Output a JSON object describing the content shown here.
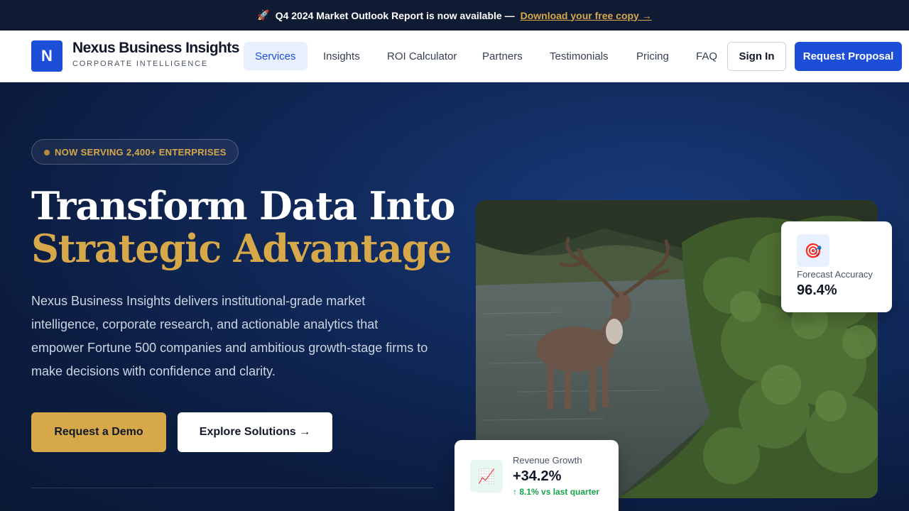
{
  "announcement": {
    "icon": "rocket-icon",
    "text": "Q4 2024 Market Outlook Report is now available —",
    "link": "Download your free copy →"
  },
  "nav": {
    "brand_initial": "N",
    "brand_name": "Nexus Business Insights",
    "brand_tagline": "CORPORATE INTELLIGENCE",
    "links": [
      {
        "label": "Services",
        "active": true
      },
      {
        "label": "Insights"
      },
      {
        "label": "ROI Calculator"
      },
      {
        "label": "Partners"
      },
      {
        "label": "Testimonials"
      },
      {
        "label": "Pricing"
      },
      {
        "label": "FAQ"
      }
    ],
    "signin_label": "Sign In",
    "cta_label": "Request Proposal"
  },
  "hero": {
    "badge": "NOW SERVING 2,400+ ENTERPRISES",
    "title_line1": "Transform Data Into",
    "title_line2": "Strategic Advantage",
    "lead": "Nexus Business Insights delivers institutional-grade market intelligence, corporate research, and actionable analytics that empower Fortune 500 companies and ambitious growth-stage firms to make decisions with confidence and clarity.",
    "primary_button": "Request a Demo",
    "secondary_button": "Explore Solutions →"
  },
  "stats": {
    "forecast": {
      "icon": "target-icon",
      "label": "Forecast Accuracy",
      "value": "96.4%"
    },
    "revenue": {
      "icon": "chart-up-icon",
      "label": "Revenue Growth",
      "value": "+34.2%",
      "delta": "↑ 8.1% vs last quarter"
    }
  },
  "colors": {
    "accent": "#1d4ed8",
    "gold": "#d6a84a",
    "hero_bg": "#0c1d42"
  }
}
